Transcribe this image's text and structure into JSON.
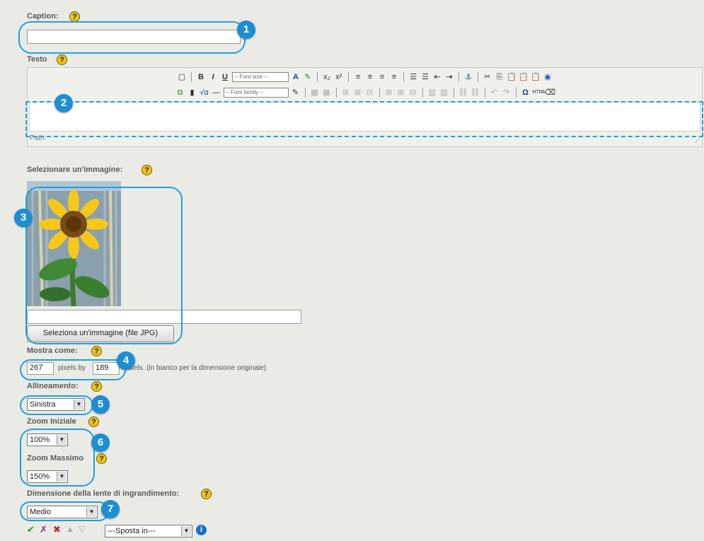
{
  "caption": {
    "label": "Caption:",
    "value": ""
  },
  "testo": {
    "label": "Testo",
    "path_label": "Path:"
  },
  "toolbar": {
    "font_size": "-- Font size --",
    "font_family": "-- Font family --"
  },
  "image": {
    "label": "Selezionare un'immagine:",
    "path_value": "",
    "button_label": "Seleziona un'immagine (file JPG)"
  },
  "mostra": {
    "label": "Mostra come:",
    "width": "267",
    "pixels_by": "pixels by",
    "height": "189",
    "hint": "pixels. (in bianco per la dimensione originale)"
  },
  "allineamento": {
    "label": "Allineamento:",
    "value": "Sinistra"
  },
  "zoom_iniziale": {
    "label": "Zoom Iniziale",
    "value": "100%"
  },
  "zoom_massimo": {
    "label": "Zoom Massimo",
    "value": "150%"
  },
  "lente": {
    "label": "Dimensione della lente di ingrandimento:",
    "value": "Medio"
  },
  "footer": {
    "sposta": "---Sposta in---"
  },
  "callouts": [
    "1",
    "2",
    "3",
    "4",
    "5",
    "6",
    "7"
  ],
  "colors": {
    "accent": "#1ea0e0",
    "background": "#ebebe6"
  }
}
